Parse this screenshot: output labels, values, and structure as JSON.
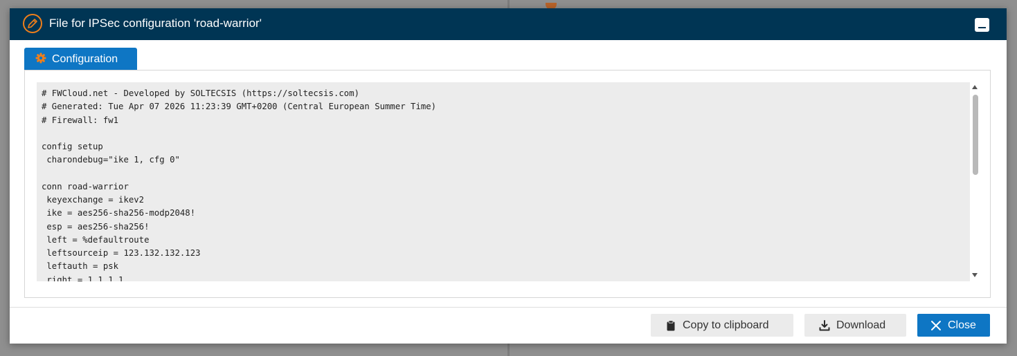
{
  "dialog": {
    "title": "File for IPSec configuration 'road-warrior'",
    "title_icon": "pencil-icon"
  },
  "tabs": [
    {
      "label": "Configuration",
      "icon": "gear-icon",
      "active": true
    }
  ],
  "config_file": {
    "content": "# FWCloud.net - Developed by SOLTECSIS (https://soltecsis.com)\n# Generated: Tue Apr 07 2026 11:23:39 GMT+0200 (Central European Summer Time)\n# Firewall: fw1\n\nconfig setup\n charondebug=\"ike 1, cfg 0\"\n\nconn road-warrior\n keyexchange = ikev2\n ike = aes256-sha256-modp2048!\n esp = aes256-sha256!\n left = %defaultroute\n leftsourceip = 123.132.132.123\n leftauth = psk\n right = 1.1.1.1"
  },
  "buttons": {
    "copy": {
      "label": "Copy to clipboard",
      "icon": "clipboard-icon"
    },
    "download": {
      "label": "Download",
      "icon": "download-icon"
    },
    "close": {
      "label": "Close",
      "icon": "close-icon"
    }
  },
  "colors": {
    "titlebar": "#003554",
    "accent": "#0e76c4",
    "tab_icon": "#f07f1a",
    "code_background": "#ececec"
  }
}
